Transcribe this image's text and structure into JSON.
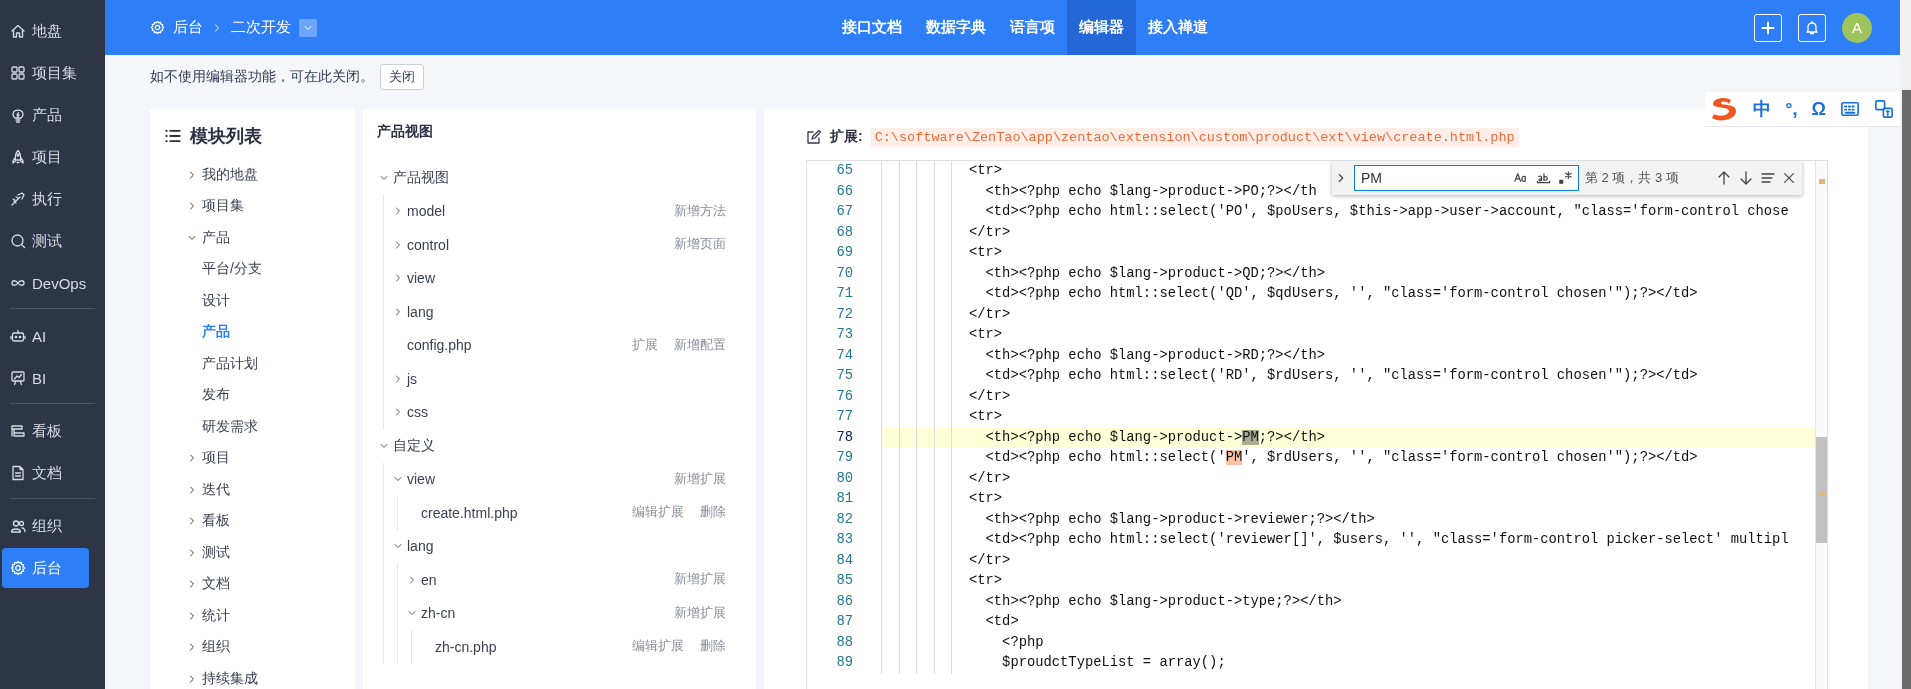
{
  "sidebar": {
    "groups": [
      [
        {
          "label": "地盘",
          "selected": false
        },
        {
          "label": "项目集",
          "selected": false
        },
        {
          "label": "产品",
          "selected": false
        },
        {
          "label": "项目",
          "selected": false
        },
        {
          "label": "执行",
          "selected": false
        },
        {
          "label": "测试",
          "selected": false
        },
        {
          "label": "DevOps",
          "selected": false
        }
      ],
      [
        {
          "label": "AI",
          "selected": false
        },
        {
          "label": "BI",
          "selected": false
        }
      ],
      [
        {
          "label": "看板",
          "selected": false
        },
        {
          "label": "文档",
          "selected": false
        }
      ],
      [
        {
          "label": "组织",
          "selected": false
        },
        {
          "label": "后台",
          "selected": true
        }
      ]
    ]
  },
  "topbar": {
    "breadcrumb": [
      "后台",
      "二次开发"
    ],
    "tabs": [
      {
        "label": "接口文档",
        "selected": false
      },
      {
        "label": "数据字典",
        "selected": false
      },
      {
        "label": "语言项",
        "selected": false
      },
      {
        "label": "编辑器",
        "selected": true
      },
      {
        "label": "接入禅道",
        "selected": false
      }
    ],
    "avatar": "A"
  },
  "notice": {
    "text": "如不使用编辑器功能，可在此关闭。",
    "button": "关闭"
  },
  "module_list": {
    "title": "模块列表",
    "items": [
      {
        "label": "我的地盘",
        "expanded": false,
        "selected": false
      },
      {
        "label": "项目集",
        "expanded": false,
        "selected": false
      },
      {
        "label": "产品",
        "expanded": true,
        "selected": false,
        "children": [
          {
            "label": "平台/分支",
            "selected": false
          },
          {
            "label": "设计",
            "selected": false
          },
          {
            "label": "产品",
            "selected": true
          },
          {
            "label": "产品计划",
            "selected": false
          },
          {
            "label": "发布",
            "selected": false
          },
          {
            "label": "研发需求",
            "selected": false
          }
        ]
      },
      {
        "label": "项目",
        "expanded": false,
        "selected": false
      },
      {
        "label": "迭代",
        "expanded": false,
        "selected": false
      },
      {
        "label": "看板",
        "expanded": false,
        "selected": false
      },
      {
        "label": "测试",
        "expanded": false,
        "selected": false
      },
      {
        "label": "文档",
        "expanded": false,
        "selected": false
      },
      {
        "label": "统计",
        "expanded": false,
        "selected": false
      },
      {
        "label": "组织",
        "expanded": false,
        "selected": false
      },
      {
        "label": "持续集成",
        "expanded": false,
        "selected": false
      }
    ]
  },
  "view_tree": {
    "title": "产品视图",
    "items": [
      {
        "label": "产品视图",
        "expanded": true,
        "children": [
          {
            "label": "model",
            "expanded": false,
            "actions": [
              "新增方法"
            ]
          },
          {
            "label": "control",
            "expanded": false,
            "actions": [
              "新增页面"
            ]
          },
          {
            "label": "view",
            "expanded": false
          },
          {
            "label": "lang",
            "expanded": false
          },
          {
            "label": "config.php",
            "actions": [
              "扩展",
              "新增配置"
            ]
          },
          {
            "label": "js",
            "expanded": false
          },
          {
            "label": "css",
            "expanded": false
          }
        ]
      },
      {
        "label": "自定义",
        "expanded": true,
        "children": [
          {
            "label": "view",
            "expanded": true,
            "actions": [
              "新增扩展"
            ],
            "children": [
              {
                "label": "create.html.php",
                "actions": [
                  "编辑扩展",
                  "删除"
                ]
              }
            ]
          },
          {
            "label": "lang",
            "expanded": true,
            "children": [
              {
                "label": "en",
                "expanded": false,
                "actions": [
                  "新增扩展"
                ]
              },
              {
                "label": "zh-cn",
                "expanded": true,
                "actions": [
                  "新增扩展"
                ],
                "children": [
                  {
                    "label": "zh-cn.php",
                    "actions": [
                      "编辑扩展",
                      "删除"
                    ]
                  }
                ]
              }
            ]
          }
        ]
      }
    ]
  },
  "editor": {
    "label": "扩展:",
    "path": "C:\\software\\ZenTao\\app\\zentao\\extension\\custom\\product\\ext\\view\\create.html.php",
    "find": {
      "value": "PM",
      "count": "第 2 项，共 3 项"
    },
    "lines": [
      {
        "number": "65",
        "current_line": false,
        "text": "<tr>"
      },
      {
        "number": "66",
        "current_line": false,
        "text": "  <th><?php echo $lang->product->PO;?></th"
      },
      {
        "number": "67",
        "current_line": false,
        "text": "  <td><?php echo html::select('PO', $poUsers, $this->app->user->account, \"class='form-control chose"
      },
      {
        "number": "68",
        "current_line": false,
        "text": "</tr>"
      },
      {
        "number": "69",
        "current_line": false,
        "text": "<tr>"
      },
      {
        "number": "70",
        "current_line": false,
        "text": "  <th><?php echo $lang->product->QD;?></th>"
      },
      {
        "number": "71",
        "current_line": false,
        "text": "  <td><?php echo html::select('QD', $qdUsers, '', \"class='form-control chosen'\");?></td>"
      },
      {
        "number": "72",
        "current_line": false,
        "text": "</tr>"
      },
      {
        "number": "73",
        "current_line": false,
        "text": "<tr>"
      },
      {
        "number": "74",
        "current_line": false,
        "text": "  <th><?php echo $lang->product->RD;?></th>"
      },
      {
        "number": "75",
        "current_line": false,
        "text": "  <td><?php echo html::select('RD', $rdUsers, '', \"class='form-control chosen'\");?></td>"
      },
      {
        "number": "76",
        "current_line": false,
        "text": "</tr>"
      },
      {
        "number": "77",
        "current_line": false,
        "text": "<tr>"
      },
      {
        "number": "78",
        "current_line": true,
        "segments": [
          {
            "text": "  <th><?php echo $lang->product->"
          },
          {
            "text": "PM",
            "match": true,
            "current": true
          },
          {
            "text": ";?></th>"
          }
        ]
      },
      {
        "number": "79",
        "current_line": false,
        "segments": [
          {
            "text": "  <td><?php echo html::select('"
          },
          {
            "text": "PM",
            "match": true,
            "current": false
          },
          {
            "text": "', $rdUsers, '', \"class='form-control chosen'\");?></td>"
          }
        ]
      },
      {
        "number": "80",
        "current_line": false,
        "text": "</tr>"
      },
      {
        "number": "81",
        "current_line": false,
        "text": "<tr>"
      },
      {
        "number": "82",
        "current_line": false,
        "text": "  <th><?php echo $lang->product->reviewer;?></th>"
      },
      {
        "number": "83",
        "current_line": false,
        "text": "  <td><?php echo html::select('reviewer[]', $users, '', \"class='form-control picker-select' multipl"
      },
      {
        "number": "84",
        "current_line": false,
        "text": "</tr>"
      },
      {
        "number": "85",
        "current_line": false,
        "text": "<tr>"
      },
      {
        "number": "86",
        "current_line": false,
        "text": "  <th><?php echo $lang->product->type;?></th>"
      },
      {
        "number": "87",
        "current_line": false,
        "text": "  <td>"
      },
      {
        "number": "88",
        "current_line": false,
        "text": "    <?php"
      },
      {
        "number": "89",
        "current_line": false,
        "text": "    $proudctTypeList = array();"
      }
    ]
  },
  "ime_toolbar": {
    "items": [
      "中",
      "°,",
      "Ω"
    ]
  }
}
